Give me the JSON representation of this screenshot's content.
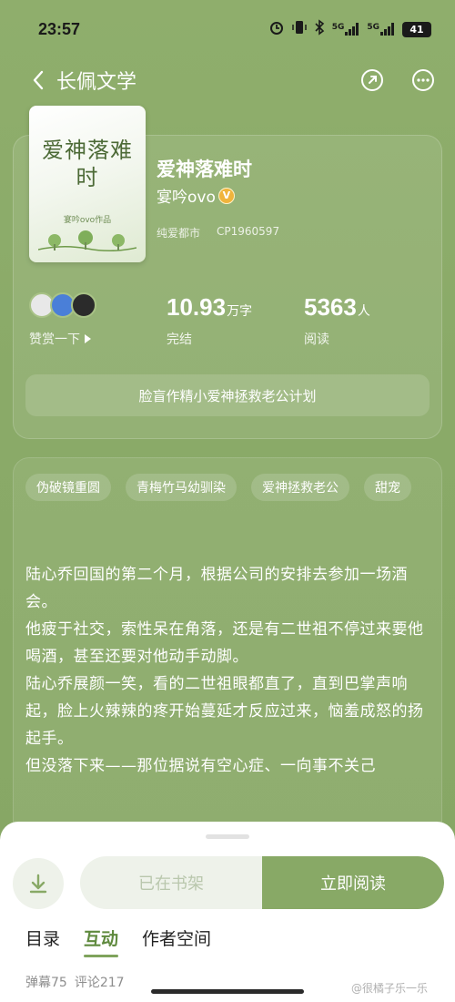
{
  "status": {
    "time": "23:57",
    "network_1": "5G",
    "network_2": "5G",
    "battery": "41"
  },
  "nav": {
    "title": "长佩文学",
    "back_icon": "chevron-left-icon",
    "share_icon": "share-icon",
    "more_icon": "more-icon"
  },
  "book": {
    "cover_title": "爱神落难时",
    "cover_author": "宴吟ovo作品",
    "title": "爱神落难时",
    "author": "宴吟ovo",
    "author_badge": "V",
    "category": "纯爱都市",
    "cp_id": "CP1960597"
  },
  "stats": {
    "reward_label": "赞赏一下",
    "words_value": "10.93",
    "words_unit": "万字",
    "words_label": "完结",
    "readers_value": "5363",
    "readers_unit": "人",
    "readers_label": "阅读"
  },
  "slogan": "脸盲作精小爱神拯救老公计划",
  "tags": [
    "伪破镜重圆",
    "青梅竹马幼驯染",
    "爱神拯救老公",
    "甜宠"
  ],
  "synopsis": [
    "陆心乔回国的第二个月，根据公司的安排去参加一场酒会。",
    "他疲于社交，索性呆在角落，还是有二世祖不停过来要他喝酒，甚至还要对他动手动脚。",
    "陆心乔展颜一笑，看的二世祖眼都直了，直到巴掌声响起，脸上火辣辣的疼开始蔓延才反应过来，恼羞成怒的扬起手。",
    "但没落下来——那位据说有空心症、一向事不关己"
  ],
  "bottom": {
    "shelf_label": "已在书架",
    "read_label": "立即阅读",
    "tabs": [
      "目录",
      "互动",
      "作者空间"
    ],
    "danmaku": "弹幕75",
    "comments": "评论217",
    "watermark": "@很橘子乐一乐"
  },
  "colors": {
    "background": "#8aaa68",
    "accent": "#88a966",
    "tab_active": "#5f8a3e"
  }
}
